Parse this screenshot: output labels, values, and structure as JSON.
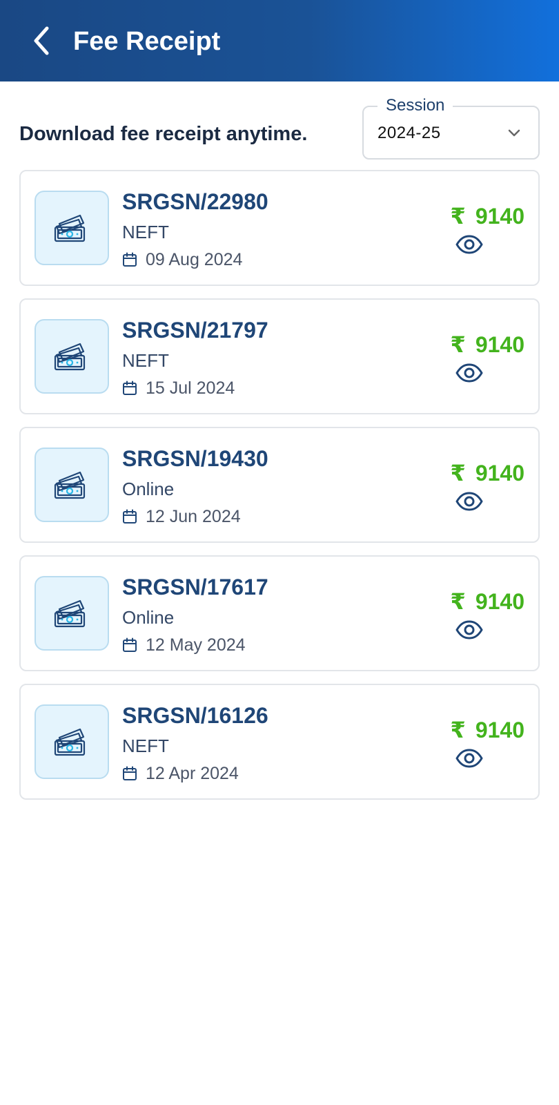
{
  "header": {
    "title": "Fee Receipt",
    "back_icon": "chevron-left-icon",
    "gradient_colors": [
      "#1a4884",
      "#1270dc"
    ]
  },
  "subtitle": "Download fee receipt anytime.",
  "session": {
    "label": "Session",
    "value": "2024-25"
  },
  "currency_symbol": "₹",
  "colors": {
    "amount": "#43b31d",
    "primary": "#1f4677",
    "thumb_bg": "#e4f4fd"
  },
  "receipts": [
    {
      "number": "SRGSN/22980",
      "mode": "NEFT",
      "date": "09 Aug 2024",
      "amount": "9140"
    },
    {
      "number": "SRGSN/21797",
      "mode": "NEFT",
      "date": "15 Jul 2024",
      "amount": "9140"
    },
    {
      "number": "SRGSN/19430",
      "mode": "Online",
      "date": "12 Jun 2024",
      "amount": "9140"
    },
    {
      "number": "SRGSN/17617",
      "mode": "Online",
      "date": "12 May 2024",
      "amount": "9140"
    },
    {
      "number": "SRGSN/16126",
      "mode": "NEFT",
      "date": "12 Apr 2024",
      "amount": "9140"
    }
  ]
}
